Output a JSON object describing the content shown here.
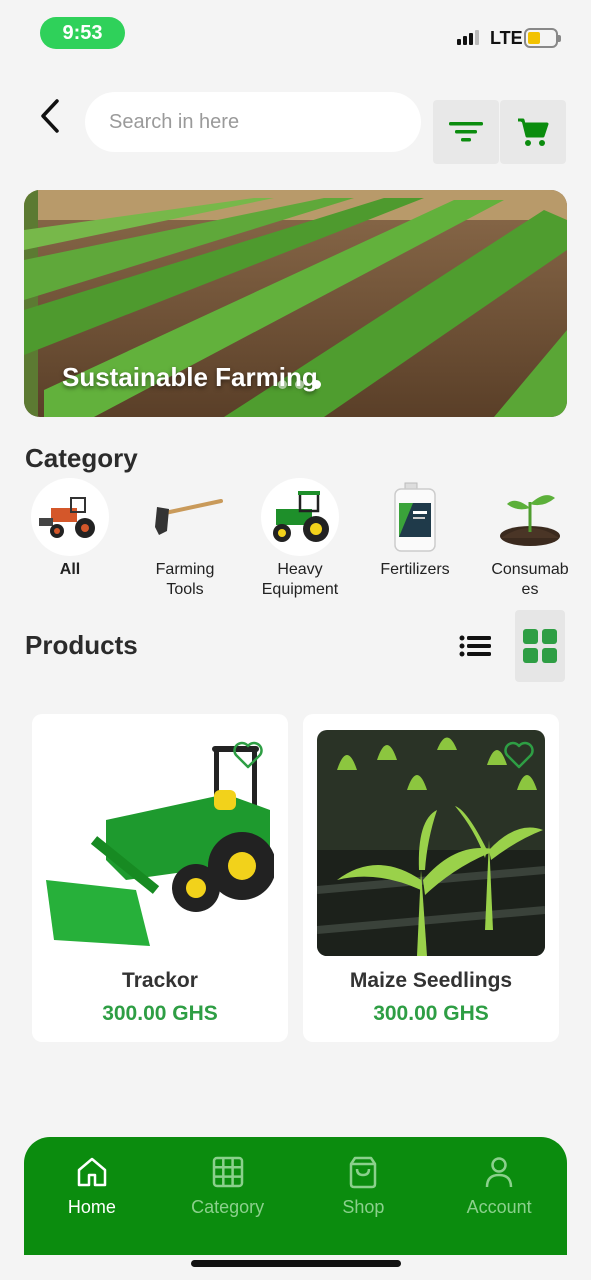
{
  "status_bar": {
    "time": "9:53",
    "network": "LTE",
    "battery_color": "#f2c200"
  },
  "header": {
    "back_icon": "chevron-left-icon",
    "search_placeholder": "Search in here",
    "search_value": "",
    "filter_icon": "filter-icon",
    "cart_icon": "cart-icon"
  },
  "banner": {
    "title": "Sustainable Farming"
  },
  "category": {
    "title": "Category",
    "items": [
      {
        "label": "All",
        "icon": "tractor-icon",
        "selected": true
      },
      {
        "label": "Farming\nTools",
        "icon": "hoe-icon"
      },
      {
        "label": "Heavy\nEquipment",
        "icon": "green-tractor-icon"
      },
      {
        "label": "Fertilizers",
        "icon": "fertilizer-jug-icon"
      },
      {
        "label": "Consumab\nes",
        "icon": "seedling-icon"
      }
    ]
  },
  "products": {
    "title": "Products",
    "list_icon": "list-view-icon",
    "grid_icon": "grid-view-icon",
    "items": [
      {
        "name": "Trackor",
        "price": "300.00 GHS",
        "image": "tractor-image"
      },
      {
        "name": "Maize Seedlings",
        "price": "300.00 GHS",
        "image": "maize-seedlings-image"
      }
    ]
  },
  "bottom_nav": {
    "items": [
      {
        "label": "Home",
        "icon": "home-icon",
        "active": true
      },
      {
        "label": "Category",
        "icon": "grid-icon"
      },
      {
        "label": "Shop",
        "icon": "shopping-bag-icon"
      },
      {
        "label": "Account",
        "icon": "user-icon"
      }
    ]
  },
  "colors": {
    "primary": "#0b8c0e",
    "price": "#2e9e44",
    "accent": "#2fd15a"
  }
}
